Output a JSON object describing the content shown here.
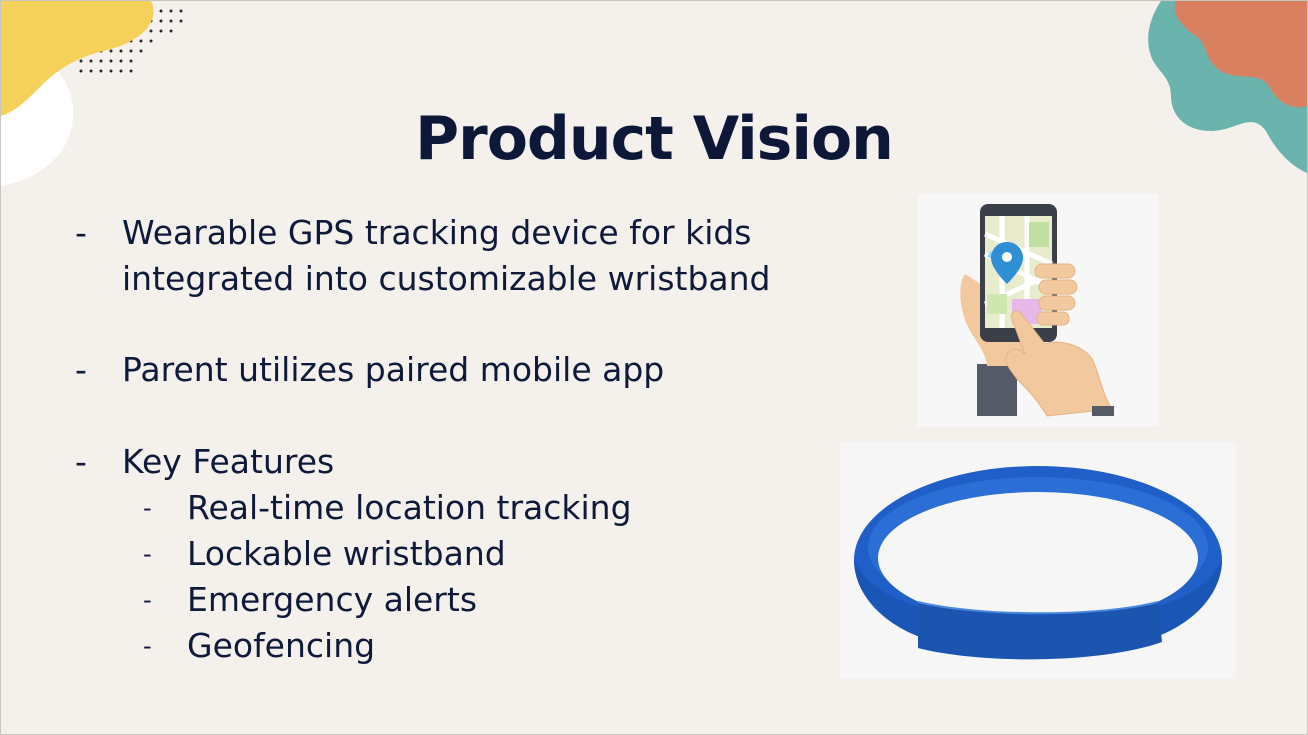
{
  "slide": {
    "title": "Product Vision",
    "bullets": [
      {
        "marker": "-",
        "lines": [
          "Wearable GPS tracking device for kids",
          "integrated into customizable wristband"
        ]
      },
      {
        "marker": "-",
        "lines": [
          "Parent utilizes paired mobile app"
        ]
      },
      {
        "marker": "-",
        "lines": [
          "Key Features"
        ]
      }
    ],
    "sub_bullets": [
      {
        "marker": "-",
        "text": "Real-time location tracking"
      },
      {
        "marker": "-",
        "text": "Lockable wristband"
      },
      {
        "marker": "-",
        "text": "Emergency alerts"
      },
      {
        "marker": "-",
        "text": "Geofencing"
      }
    ]
  },
  "images": {
    "phone": "phone-map-illustration",
    "wristband": "blue-silicone-wristband-photo"
  },
  "colors": {
    "background": "#f4f1ec",
    "title": "#0d1738",
    "text": "#0f1a3a",
    "yellow_blob": "#f5d15c",
    "teal_blob": "#6bb3ad",
    "orange_blob": "#d98061",
    "wristband": "#1f5fc7"
  }
}
